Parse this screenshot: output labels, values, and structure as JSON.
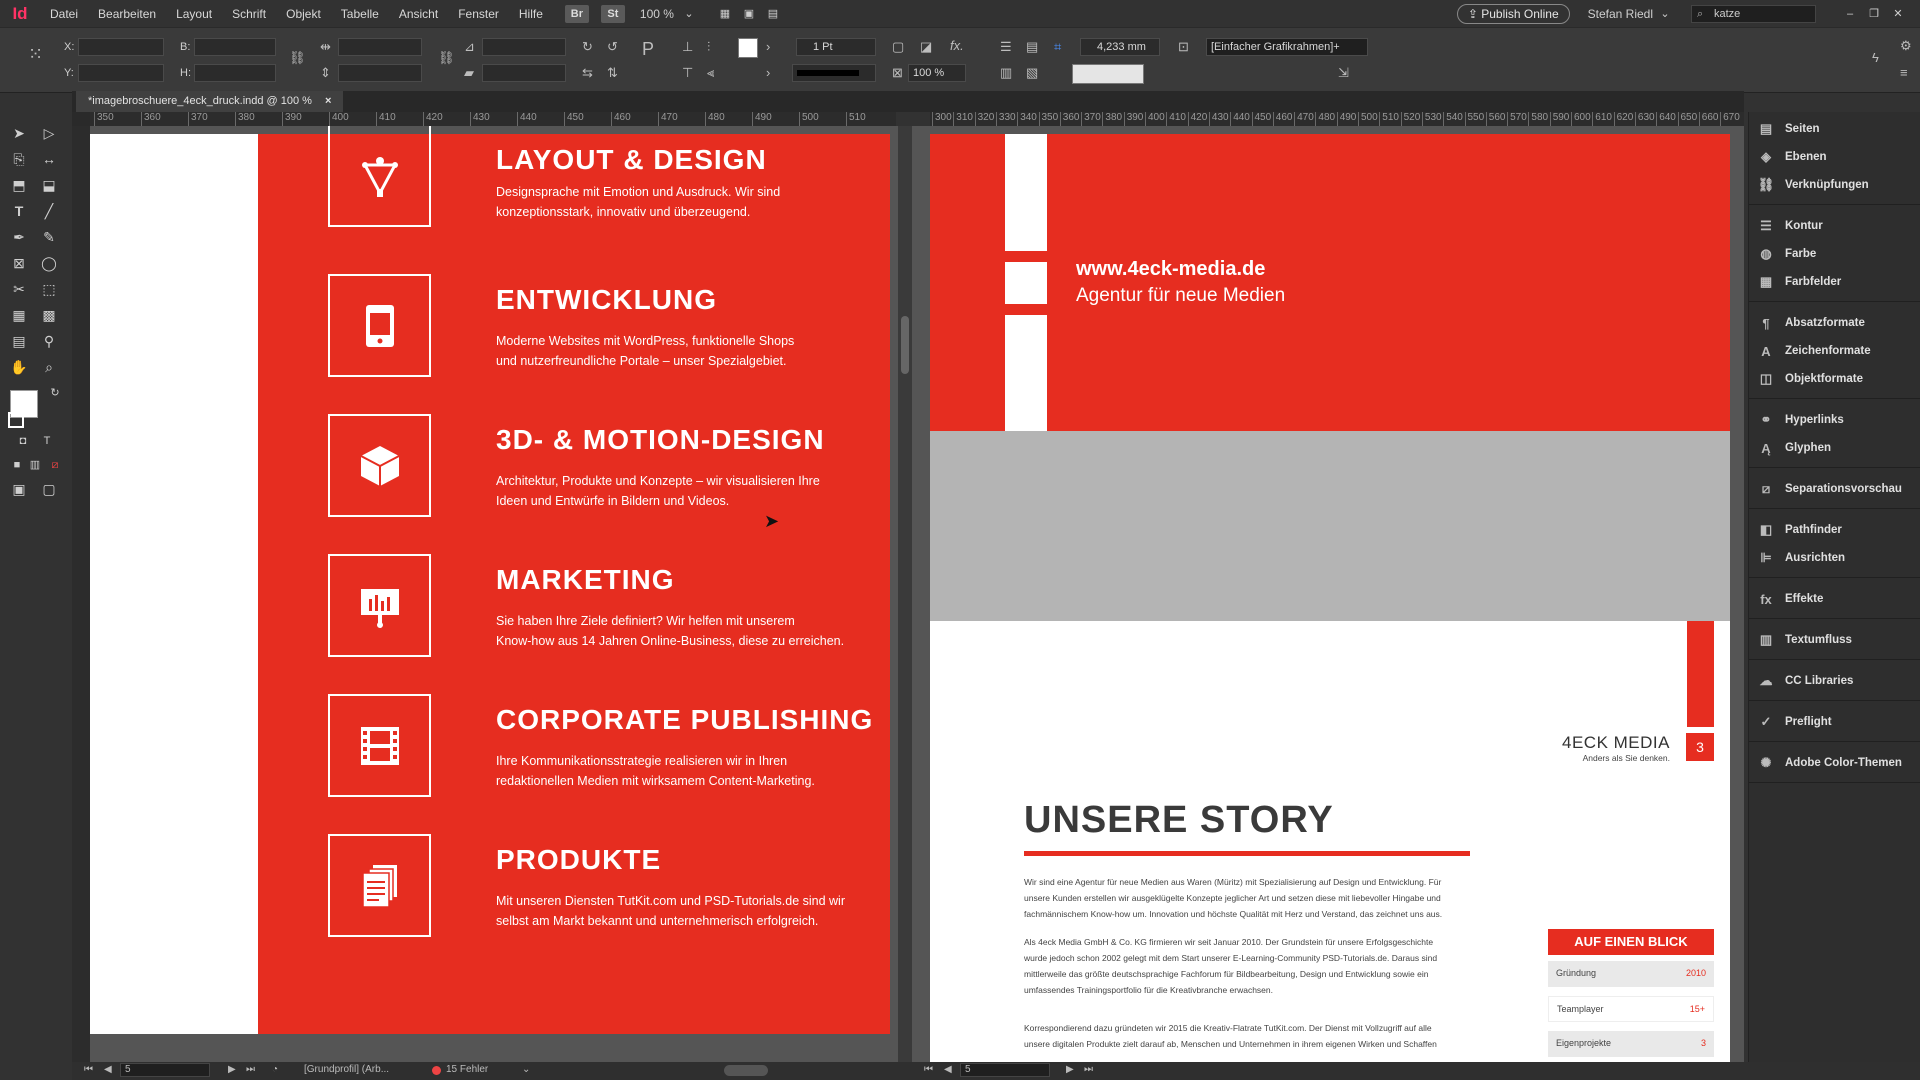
{
  "menubar": {
    "app_logo": "Id",
    "menus": [
      "Datei",
      "Bearbeiten",
      "Layout",
      "Schrift",
      "Objekt",
      "Tabelle",
      "Ansicht",
      "Fenster",
      "Hilfe"
    ],
    "bridge": "Br",
    "stock": "St",
    "zoom": "100 %",
    "publish": "Publish Online",
    "user": "Stefan Riedl",
    "search_value": "katze"
  },
  "control": {
    "x_label": "X:",
    "y_label": "Y:",
    "b_label": "B:",
    "h_label": "H:",
    "stroke_weight": "1 Pt",
    "dimension": "4,233 mm",
    "scale": "100 %",
    "frame_style": "[Einfacher Grafikrahmen]+"
  },
  "document_tab": {
    "title": "*imagebroschuere_4eck_druck.indd @ 100 %",
    "close": "×"
  },
  "ruler_left": [
    "350",
    "360",
    "370",
    "380",
    "390",
    "400",
    "410",
    "420",
    "430",
    "440",
    "450",
    "460",
    "470",
    "480",
    "490",
    "500",
    "510"
  ],
  "ruler_right": [
    "300",
    "310",
    "320",
    "330",
    "340",
    "350",
    "360",
    "370",
    "380",
    "390",
    "400",
    "410",
    "420",
    "430",
    "440",
    "450",
    "460",
    "470",
    "480",
    "490",
    "500",
    "510",
    "520",
    "530",
    "540",
    "550",
    "560",
    "570",
    "580",
    "590",
    "600",
    "610",
    "620",
    "630",
    "640",
    "650",
    "660",
    "670"
  ],
  "services": [
    {
      "title": "LAYOUT & DESIGN",
      "desc1": "Designsprache mit Emotion und Ausdruck. Wir sind",
      "desc2": "konzeptionsstark, innovativ und überzeugend.",
      "icon": "pen-tool-icon"
    },
    {
      "title": "ENTWICKLUNG",
      "desc1": "Moderne Websites mit WordPress, funktionelle Shops",
      "desc2": "und nutzerfreundliche Portale – unser Spezialgebiet.",
      "icon": "tablet-icon"
    },
    {
      "title": "3D- & MOTION-DESIGN",
      "desc1": "Architektur, Produkte und Konzepte – wir visualisieren Ihre",
      "desc2": "Ideen und Entwürfe in Bildern und Videos.",
      "icon": "cube-icon"
    },
    {
      "title": "MARKETING",
      "desc1": "Sie haben Ihre Ziele definiert? Wir helfen mit unserem",
      "desc2": "Know-how aus 14 Jahren Online-Business, diese zu erreichen.",
      "icon": "presentation-chart-icon"
    },
    {
      "title": "CORPORATE PUBLISHING",
      "desc1": "Ihre Kommunikationsstrategie realisieren wir in Ihren",
      "desc2": "redaktionellen Medien mit wirksamem Content-Marketing.",
      "icon": "film-strip-icon"
    },
    {
      "title": "PRODUKTE",
      "desc1": "Mit unseren Diensten TutKit.com und PSD-Tutorials.de sind wir",
      "desc2": "selbst am Markt bekannt und unternehmerisch erfolgreich.",
      "icon": "documents-icon"
    }
  ],
  "right_page": {
    "url": "www.4eck-media.de",
    "tagline": "Agentur für neue Medien",
    "brand": "4ECK MEDIA",
    "brand_sub": "Anders als Sie denken.",
    "page_number": "3",
    "story_title": "UNSERE STORY",
    "para1": [
      "Wir sind eine Agentur für neue Medien aus Waren (Müritz) mit Spezialisierung auf Design und Entwicklung. Für",
      "unsere Kunden erstellen wir ausgeklügelte Konzepte jeglicher Art und setzen diese mit liebevoller Hingabe und",
      "fachmännischem Know-how um. Innovation und höchste Qualität mit Herz und Verstand, das zeichnet uns aus."
    ],
    "para2": [
      "Als 4eck Media GmbH & Co. KG firmieren wir seit Januar 2010. Der Grundstein für unsere Erfolgsgeschichte",
      "wurde jedoch schon 2002 gelegt mit dem Start unserer E-Learning-Community PSD-Tutorials.de. Daraus sind",
      "mittlerweile das größte deutschsprachige Fachforum für Bildbearbeitung, Design und Entwicklung sowie ein",
      "umfassendes Trainingsportfolio für die Kreativbranche erwachsen."
    ],
    "para3": [
      "Korrespondierend dazu gründeten wir 2015 die Kreativ-Flatrate TutKit.com. Der Dienst mit Vollzugriff auf alle",
      "unsere digitalen Produkte zielt darauf ab, Menschen und Unternehmen in ihrem eigenen Wirken und Schaffen"
    ],
    "glance_title": "AUF EINEN BLICK",
    "glance": [
      {
        "label": "Gründung",
        "value": "2010"
      },
      {
        "label": "Teamplayer",
        "value": "15+"
      },
      {
        "label": "Eigenprojekte",
        "value": "3"
      }
    ]
  },
  "panels": [
    {
      "label": "Seiten",
      "icon": "pages-icon"
    },
    {
      "label": "Ebenen",
      "icon": "layers-icon"
    },
    {
      "label": "Verknüpfungen",
      "icon": "links-icon"
    },
    {
      "label": "Kontur",
      "icon": "stroke-icon"
    },
    {
      "label": "Farbe",
      "icon": "color-icon"
    },
    {
      "label": "Farbfelder",
      "icon": "swatches-icon"
    },
    {
      "label": "Absatzformate",
      "icon": "paragraph-styles-icon"
    },
    {
      "label": "Zeichenformate",
      "icon": "character-styles-icon"
    },
    {
      "label": "Objektformate",
      "icon": "object-styles-icon"
    },
    {
      "label": "Hyperlinks",
      "icon": "hyperlinks-icon"
    },
    {
      "label": "Glyphen",
      "icon": "glyphs-icon"
    },
    {
      "label": "Separationsvorschau",
      "icon": "separations-icon"
    },
    {
      "label": "Pathfinder",
      "icon": "pathfinder-icon"
    },
    {
      "label": "Ausrichten",
      "icon": "align-icon"
    },
    {
      "label": "Effekte",
      "icon": "effects-icon"
    },
    {
      "label": "Textumfluss",
      "icon": "text-wrap-icon"
    },
    {
      "label": "CC Libraries",
      "icon": "cc-libraries-icon"
    },
    {
      "label": "Preflight",
      "icon": "preflight-icon"
    },
    {
      "label": "Adobe Color-Themen",
      "icon": "color-themes-icon"
    }
  ],
  "statusbar": {
    "page_left": "5",
    "profile": "[Grundprofil] (Arb...",
    "errors": "15 Fehler",
    "page_right": "5"
  },
  "colors": {
    "brand_red": "#e62d20",
    "ui_dark": "#323232"
  }
}
